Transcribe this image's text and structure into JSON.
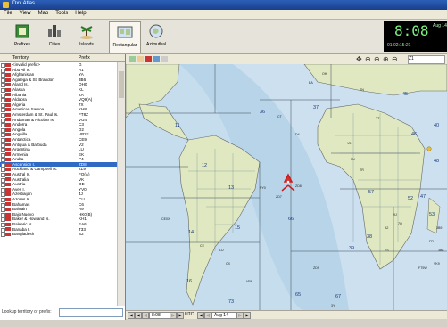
{
  "app": {
    "title": "Dxx Atlas"
  },
  "menu": [
    "File",
    "View",
    "Map",
    "Tools",
    "Help"
  ],
  "toolbar": {
    "buttons": [
      {
        "label": "Prefixes",
        "icon": "prefixes-icon"
      },
      {
        "label": "Cities",
        "icon": "cities-icon"
      },
      {
        "label": "Islands",
        "icon": "islands-icon"
      },
      {
        "label": "Rectangular",
        "icon": "rectangular-map-icon"
      },
      {
        "label": "Azimuthal",
        "icon": "azimuthal-map-icon"
      }
    ]
  },
  "clock": {
    "time": "8:08",
    "date": "Aug 14",
    "sub": "01:02:15:21"
  },
  "territory_panel": {
    "col_territory": "Territory",
    "col_prefix": "Prefix",
    "rows": [
      {
        "name": "<invalid prefix>",
        "prefix": "G"
      },
      {
        "name": "Abu Ail Is.",
        "prefix": "A1"
      },
      {
        "name": "Afghanistan",
        "prefix": "YA"
      },
      {
        "name": "Agalega & St. Brandon",
        "prefix": "3B6"
      },
      {
        "name": "Aland Is.",
        "prefix": "OH0"
      },
      {
        "name": "Alaska",
        "prefix": "KL"
      },
      {
        "name": "Albania",
        "prefix": "ZA"
      },
      {
        "name": "Aldabra",
        "prefix": "VQ9(A)"
      },
      {
        "name": "Algeria",
        "prefix": "7X"
      },
      {
        "name": "American Samoa",
        "prefix": "KH8"
      },
      {
        "name": "Amsterdam & St. Paul Is.",
        "prefix": "FT8Z"
      },
      {
        "name": "Andaman & Nicobar Is.",
        "prefix": "VU4"
      },
      {
        "name": "Andorra",
        "prefix": "C3"
      },
      {
        "name": "Angola",
        "prefix": "D2"
      },
      {
        "name": "Anguilla",
        "prefix": "VP2E"
      },
      {
        "name": "Antarctica",
        "prefix": "CE9"
      },
      {
        "name": "Antigua & Barbuda",
        "prefix": "V2"
      },
      {
        "name": "Argentina",
        "prefix": "LU"
      },
      {
        "name": "Armenia",
        "prefix": "EK"
      },
      {
        "name": "Aruba",
        "prefix": "P4"
      },
      {
        "name": "Ascension I.",
        "prefix": "ZD8"
      },
      {
        "name": "Auckland & Campbell Is.",
        "prefix": "ZL9"
      },
      {
        "name": "Austral Is.",
        "prefix": "FO(A)"
      },
      {
        "name": "Australia",
        "prefix": "VK"
      },
      {
        "name": "Austria",
        "prefix": "OE"
      },
      {
        "name": "Aves I.",
        "prefix": "YV0"
      },
      {
        "name": "Azerbaijan",
        "prefix": "4J"
      },
      {
        "name": "Azores Is.",
        "prefix": "CU"
      },
      {
        "name": "Bahamas",
        "prefix": "C6"
      },
      {
        "name": "Bahrain",
        "prefix": "A9"
      },
      {
        "name": "Bajo Nuevo",
        "prefix": "HK0(B)"
      },
      {
        "name": "Baker & Howland Is.",
        "prefix": "KH1"
      },
      {
        "name": "Balearic Is.",
        "prefix": "EA6"
      },
      {
        "name": "Banaba I.",
        "prefix": "T33"
      },
      {
        "name": "Bangladesh",
        "prefix": "S2"
      }
    ],
    "selected_index": 20,
    "lookup_label": "Lookup territory or prefix:",
    "lookup_value": ""
  },
  "map_toolbar": {
    "search_value": "Z1"
  },
  "map": {
    "labels": [
      "36",
      "37",
      "45",
      "46",
      "47",
      "48",
      "11",
      "12",
      "13",
      "14",
      "15",
      "16",
      "65",
      "66",
      "67",
      "57",
      "52",
      "53",
      "38",
      "39",
      "40",
      "73",
      "OH",
      "CT",
      "EA",
      "D4",
      "ZD7",
      "ZD8",
      "PY0",
      "LU",
      "CE",
      "CX",
      "ZS",
      "A2",
      "V5",
      "TR",
      "TN",
      "TT",
      "5N",
      "9J",
      "7Q",
      "FR",
      "3B8",
      "3B9",
      "FT5W",
      "VK9",
      "VP8",
      "ZD9",
      "3Y",
      "CE0X"
    ]
  },
  "status": {
    "time": "8:08",
    "utc_label": "UTC",
    "date": "Aug 14"
  }
}
